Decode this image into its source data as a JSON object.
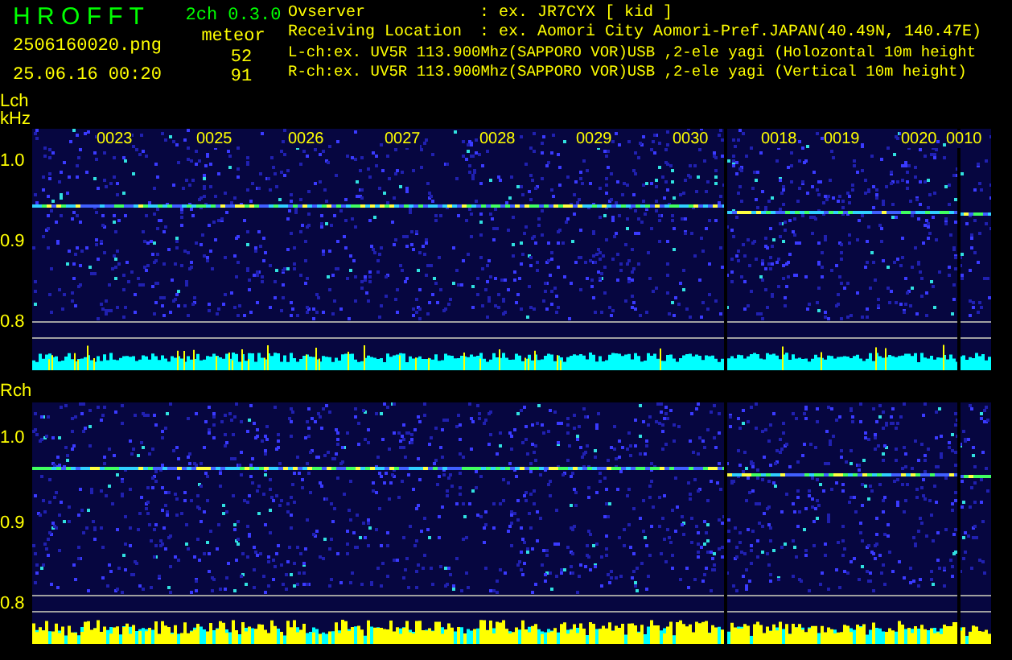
{
  "app": {
    "title": "H R O F F T",
    "version": "2ch 0.3.0"
  },
  "file": {
    "name": "2506160020.png",
    "timestamp": "25.06.16 00:20"
  },
  "meteor": {
    "label": "meteor",
    "counts": [
      "52",
      "91"
    ]
  },
  "info": [
    {
      "kind": "field",
      "label": "Ovserver",
      "value": ": ex. JR7CYX [ kid ]"
    },
    {
      "kind": "field",
      "label": "Receiving Location",
      "value": ": ex. Aomori City Aomori-Pref.JAPAN(40.49N, 140.47E)"
    },
    {
      "kind": "line",
      "text": "L-ch:ex. UV5R 113.900Mhz(SAPPORO VOR)USB ,2-ele yagi (Holozontal 10m height"
    },
    {
      "kind": "line",
      "text": "R-ch:ex. UV5R 113.900Mhz(SAPPORO VOR)USB ,2-ele yagi (Vertical 10m height)"
    }
  ],
  "panels": [
    {
      "titles": [
        "Lch",
        "kHz"
      ],
      "yticks": [
        "1.0",
        "0.9",
        "0.8"
      ],
      "times": [
        "0023",
        "0025",
        "0026",
        "0027",
        "0028",
        "0029",
        "0030",
        "0018",
        "0019",
        "0020",
        "0010"
      ]
    },
    {
      "titles": [
        "Rch"
      ],
      "yticks": [
        "1.0",
        "0.9",
        "0.8"
      ]
    }
  ]
}
